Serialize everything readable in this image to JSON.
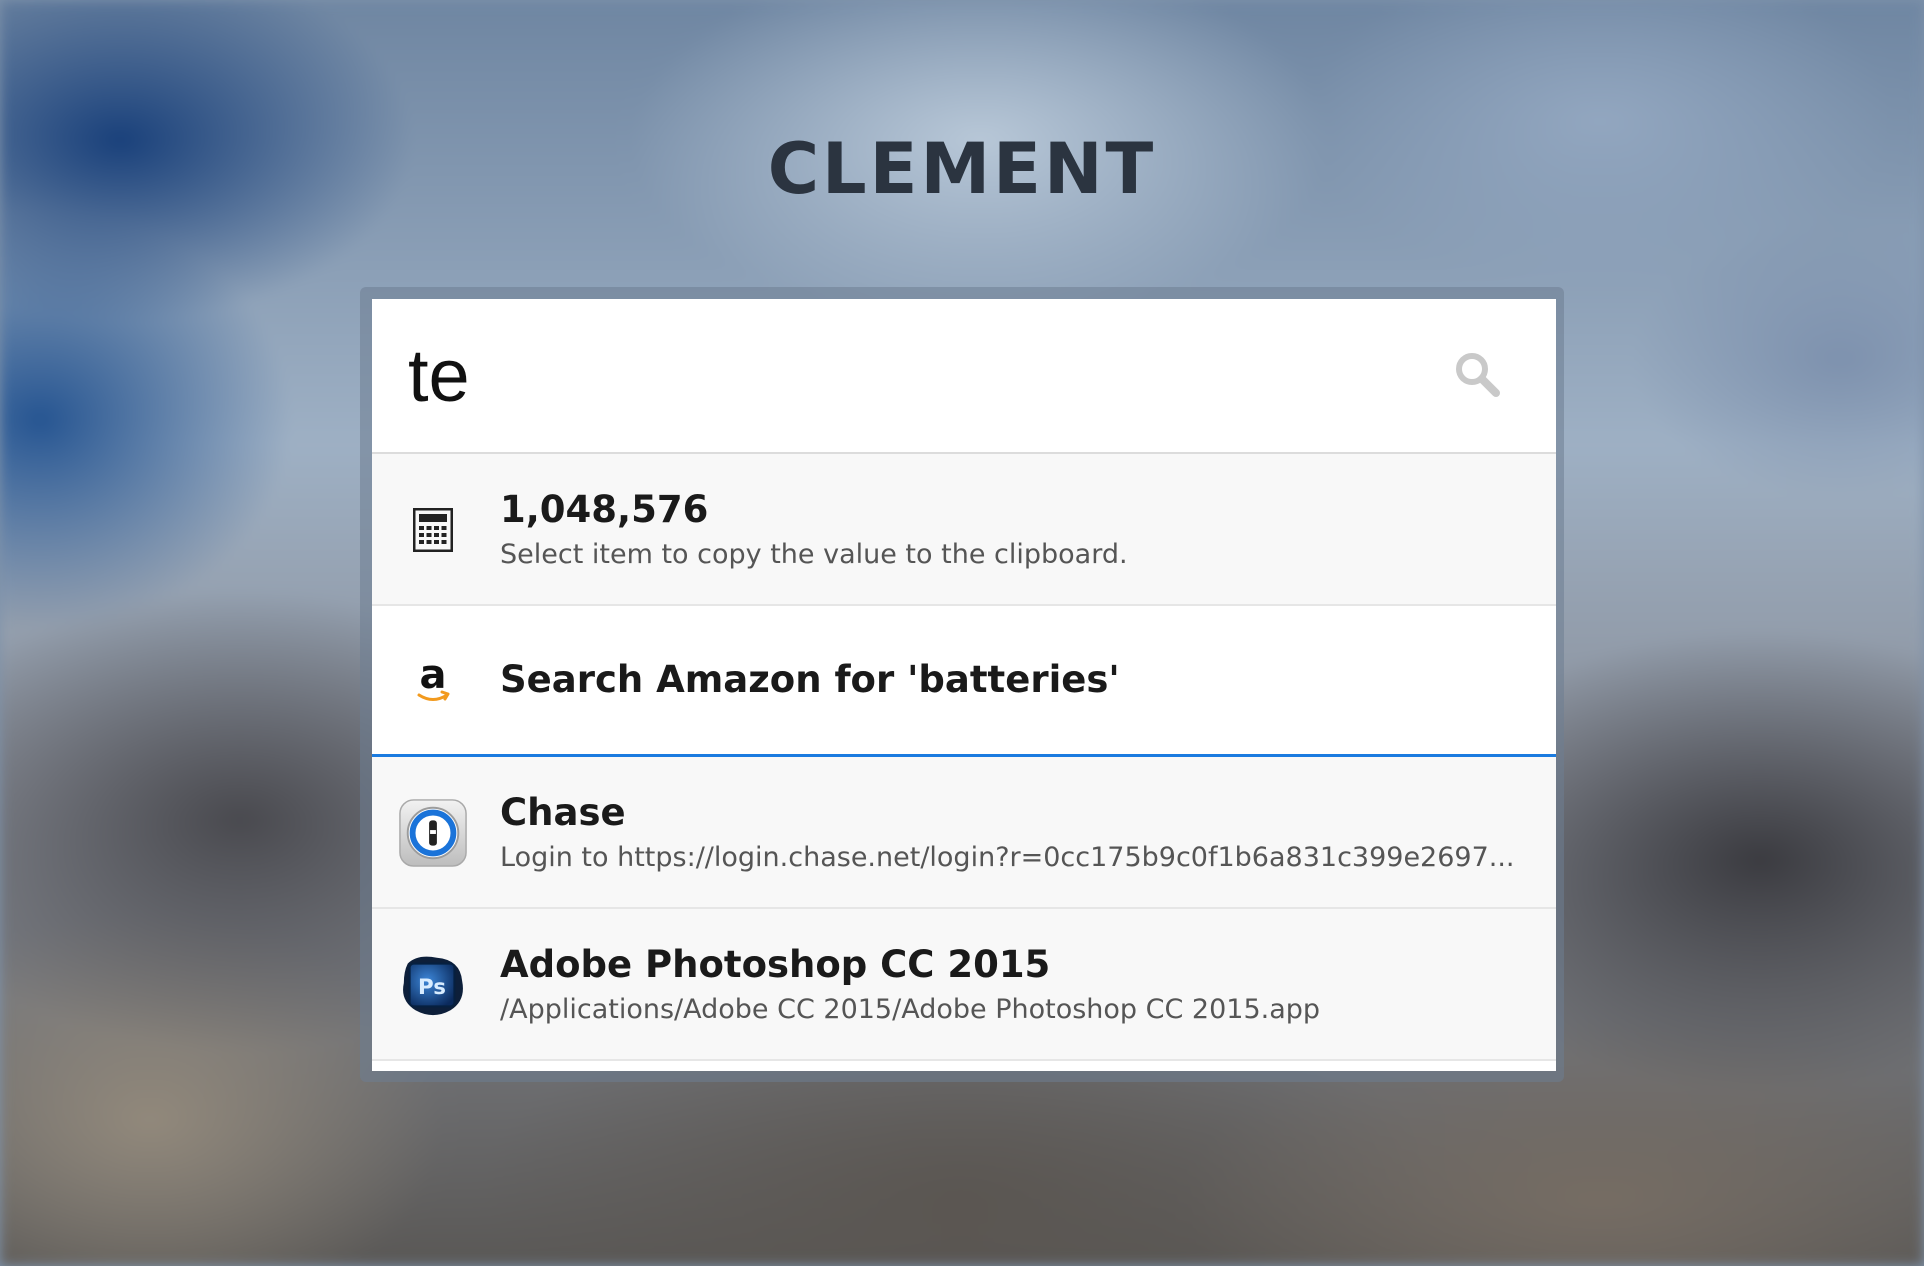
{
  "app": {
    "title": "CLEMENT"
  },
  "search": {
    "value": "te",
    "icon": "search-icon"
  },
  "results": [
    {
      "icon": "calculator-icon",
      "name": "1,048,576",
      "subtitle": "Select item to copy the value to the clipboard.",
      "selected": false
    },
    {
      "icon": "amazon-icon",
      "name": "Search Amazon for 'batteries'",
      "subtitle": "",
      "selected": true
    },
    {
      "icon": "1password-icon",
      "name": "Chase",
      "subtitle": "Login to https://login.chase.net/login?r=0cc175b9c0f1b6a831c399e2697...",
      "selected": false
    },
    {
      "icon": "photoshop-icon",
      "icon_text": "Ps",
      "name": "Adobe Photoshop CC 2015",
      "subtitle": "/Applications/Adobe CC 2015/Adobe Photoshop CC 2015.app",
      "selected": false
    }
  ],
  "colors": {
    "selection_accent": "#1b7be0",
    "title": "#2b3440"
  }
}
